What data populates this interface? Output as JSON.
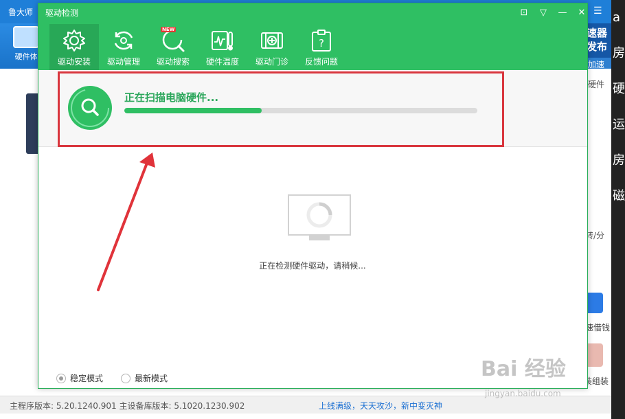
{
  "background_app": {
    "title": "鲁大师",
    "hardware_tab_label": "硬件体",
    "banner_text": "速器 发布",
    "banner_accel": "加速",
    "side_texts": [
      "硬件",
      "转/分",
      "速借钱",
      "装组装"
    ],
    "edge_glyphs": [
      "a",
      "房",
      "硬",
      "运",
      "房",
      "磁"
    ],
    "status": {
      "version_text": "主程序版本: 5.20.1240.901  主设备库版本: 5.1020.1230.902",
      "slogan": "上线满级，天天攻沙，新中变灭神"
    }
  },
  "dialog": {
    "title": "驱动检测",
    "controls": {
      "feedback": "⊡",
      "menu": "▽",
      "minimize": "—",
      "close": "✕"
    },
    "tabs": [
      {
        "label": "驱动安装",
        "icon": "gear-icon",
        "active": true
      },
      {
        "label": "驱动管理",
        "icon": "refresh-icon",
        "active": false
      },
      {
        "label": "驱动搜索",
        "icon": "search-icon",
        "active": false,
        "badge": "NEW"
      },
      {
        "label": "硬件温度",
        "icon": "thermometer-icon",
        "active": false
      },
      {
        "label": "驱动门诊",
        "icon": "clinic-icon",
        "active": false
      },
      {
        "label": "反馈问题",
        "icon": "question-icon",
        "active": false
      }
    ],
    "scan": {
      "status_text": "正在扫描电脑硬件...",
      "progress": 0.39
    },
    "detecting_text": "正在检测硬件驱动，请稍候...",
    "modes": [
      {
        "label": "稳定模式",
        "selected": true
      },
      {
        "label": "最新模式",
        "selected": false
      }
    ]
  },
  "watermark": {
    "logo_text": "Bai 经验",
    "url": "jingyan.baidu.com"
  },
  "colors": {
    "dialog_green": "#2fbf63",
    "annotation_red": "#d9363e",
    "app_blue": "#1f7fd8"
  }
}
